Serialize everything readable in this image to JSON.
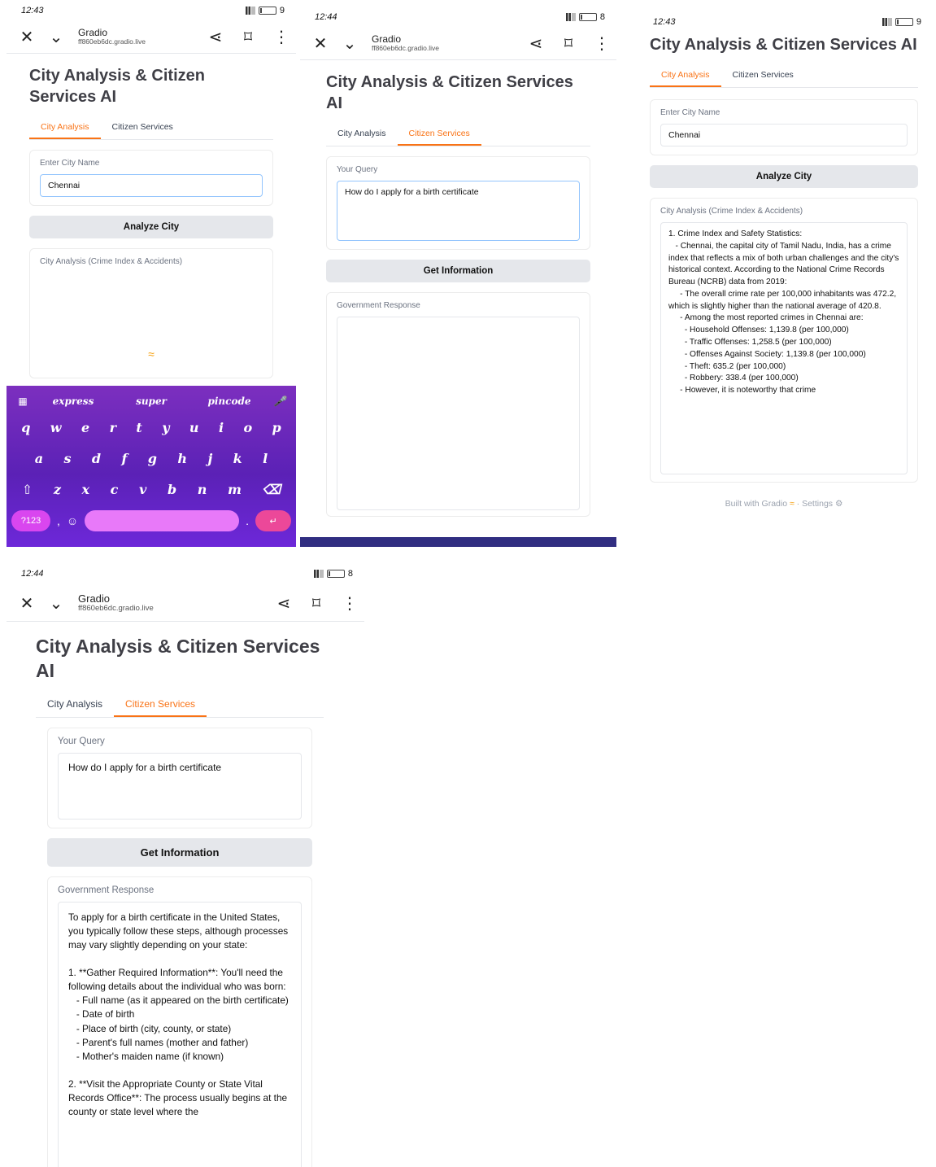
{
  "s1": {
    "status": {
      "time": "12:43",
      "right": "9"
    },
    "browser": {
      "title": "Gradio",
      "url": "ff860eb6dc.gradio.live"
    },
    "app_title": "City Analysis & Citizen Services AI",
    "tabs": [
      "City Analysis",
      "Citizen Services"
    ],
    "city_label": "Enter City Name",
    "city_value": "Chennai",
    "analyze_label": "Analyze City",
    "output_label": "City Analysis (Crime Index & Accidents)",
    "keyboard": {
      "suggestions": [
        "express",
        "super",
        "pincode"
      ],
      "row1": [
        "q",
        "w",
        "e",
        "r",
        "t",
        "y",
        "u",
        "i",
        "o",
        "p"
      ],
      "row2": [
        "a",
        "s",
        "d",
        "f",
        "g",
        "h",
        "j",
        "k",
        "l"
      ],
      "row3": [
        "z",
        "x",
        "c",
        "v",
        "b",
        "n",
        "m"
      ],
      "sym": "?123"
    }
  },
  "s2": {
    "status": {
      "time": "12:44",
      "right": "8"
    },
    "browser": {
      "title": "Gradio",
      "url": "ff860eb6dc.gradio.live"
    },
    "app_title": "City Analysis & Citizen Services AI",
    "tabs": [
      "City Analysis",
      "Citizen Services"
    ],
    "query_label": "Your Query",
    "query_value": "How do I apply for a birth certificate",
    "button_label": "Get Information",
    "response_label": "Government Response"
  },
  "s3": {
    "status": {
      "time": "12:43",
      "right": "9"
    },
    "app_title": "City Analysis & Citizen Services AI",
    "tabs": [
      "City Analysis",
      "Citizen Services"
    ],
    "city_label": "Enter City Name",
    "city_value": "Chennai",
    "analyze_label": "Analyze City",
    "output_label": "City Analysis (Crime Index & Accidents)",
    "output_text": "1. Crime Index and Safety Statistics:\n   - Chennai, the capital city of Tamil Nadu, India, has a crime index that reflects a mix of both urban challenges and the city's historical context. According to the National Crime Records Bureau (NCRB) data from 2019:\n     - The overall crime rate per 100,000 inhabitants was 472.2, which is slightly higher than the national average of 420.8.\n     - Among the most reported crimes in Chennai are:\n       - Household Offenses: 1,139.8 (per 100,000)\n       - Traffic Offenses: 1,258.5 (per 100,000)\n       - Offenses Against Society: 1,139.8 (per 100,000)\n       - Theft: 635.2 (per 100,000)\n       - Robbery: 338.4 (per 100,000)\n     - However, it is noteworthy that crime",
    "footer_built": "Built with Gradio",
    "footer_settings": "Settings"
  },
  "s4": {
    "status": {
      "time": "12:44",
      "right": "8"
    },
    "browser": {
      "title": "Gradio",
      "url": "ff860eb6dc.gradio.live"
    },
    "app_title": "City Analysis & Citizen Services AI",
    "tabs": [
      "City Analysis",
      "Citizen Services"
    ],
    "query_label": "Your Query",
    "query_value": "How do I apply for a birth certificate",
    "button_label": "Get Information",
    "response_label": "Government Response",
    "response_text": "To apply for a birth certificate in the United States, you typically follow these steps, although processes may vary slightly depending on your state:\n\n1. **Gather Required Information**: You'll need the following details about the individual who was born:\n   - Full name (as it appeared on the birth certificate)\n   - Date of birth\n   - Place of birth (city, county, or state)\n   - Parent's full names (mother and father)\n   - Mother's maiden name (if known)\n\n2. **Visit the Appropriate County or State Vital Records Office**: The process usually begins at the county or state level where the"
  }
}
